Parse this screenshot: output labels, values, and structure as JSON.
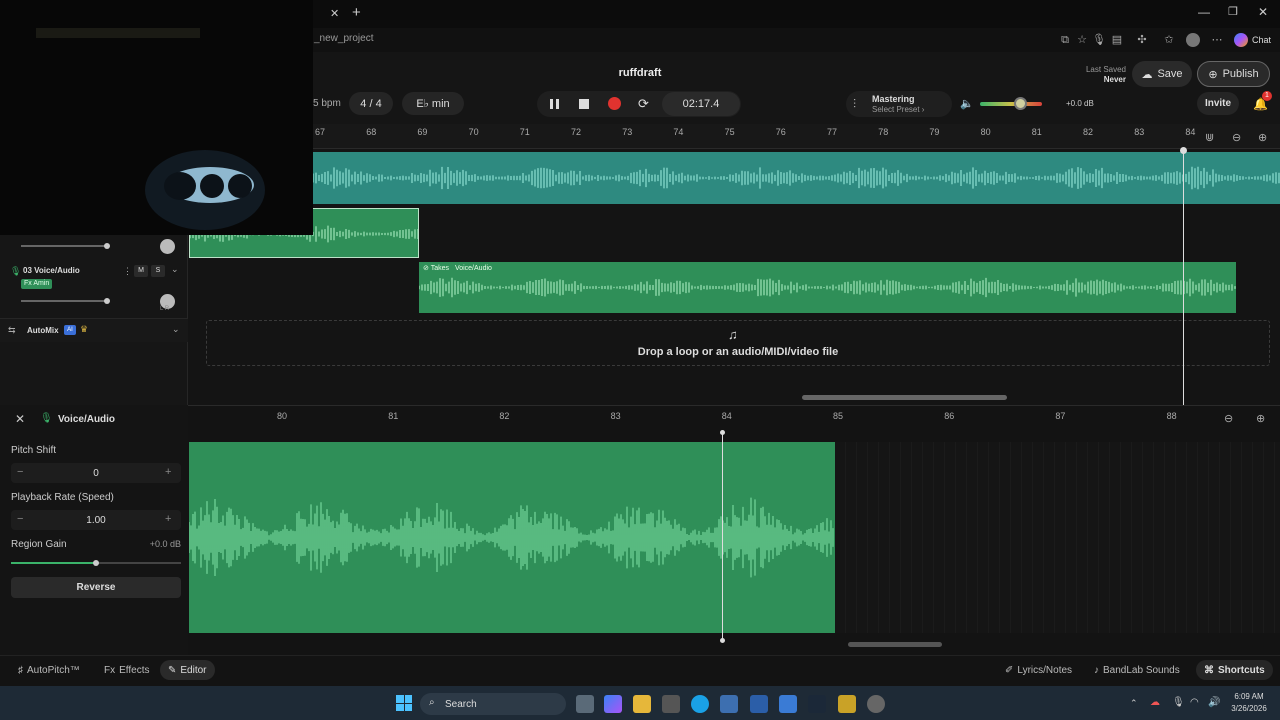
{
  "browser": {
    "close_tab_glyph": "✕",
    "new_tab_glyph": "+",
    "url": "_new_project",
    "chat_label": "Chat"
  },
  "header": {
    "song_title": "ruffdraft",
    "bpm_fragment": "5 bpm",
    "time_signature": "4 / 4",
    "key": "E♭ min",
    "time_display": "02:17.4",
    "mastering_title": "Mastering",
    "mastering_sub": "Select Preset ›",
    "volume_db": "+0.0 dB",
    "last_saved_label": "Last Saved",
    "last_saved_value": "Never",
    "save_label": "Save",
    "publish_label": "Publish",
    "invite_label": "Invite",
    "notification_count": "1",
    "volume_level": 0.65
  },
  "timeline": {
    "bars": [
      "67",
      "68",
      "69",
      "70",
      "71",
      "72",
      "73",
      "74",
      "75",
      "76",
      "77",
      "78",
      "79",
      "80",
      "81",
      "82",
      "83",
      "84"
    ]
  },
  "tracks": {
    "track3_name": "03  Voice/Audio",
    "track3_m": "M",
    "track3_s": "S",
    "track3_fx": "Fx Amin",
    "takes_label": "Takes",
    "takes_sub": "Voice/Audio",
    "automix_label": "AutoMix",
    "automix_badge": "AI",
    "drop_text": "Drop a loop or an audio/MIDI/video file",
    "lr": "L  R"
  },
  "editor": {
    "title": "Voice/Audio",
    "pitch_label": "Pitch Shift",
    "pitch_value": "0",
    "rate_label": "Playback Rate (Speed)",
    "rate_value": "1.00",
    "gain_label": "Region Gain",
    "gain_value": "+0.0 dB",
    "reverse_label": "Reverse",
    "minus": "−",
    "plus": "+",
    "bars": [
      "80",
      "81",
      "82",
      "83",
      "84",
      "85",
      "86",
      "87",
      "88"
    ]
  },
  "bottom": {
    "autopitch": "AutoPitch™",
    "effects": "Effects",
    "editor": "Editor",
    "lyrics": "Lyrics/Notes",
    "sounds": "BandLab Sounds",
    "shortcuts": "Shortcuts"
  },
  "taskbar": {
    "search": "Search",
    "time": "6:09 AM",
    "date": "3/26/2026"
  },
  "colors": {
    "accent_green": "#2f8f58",
    "teal": "#2e8a80",
    "record_red": "#e0332f"
  }
}
